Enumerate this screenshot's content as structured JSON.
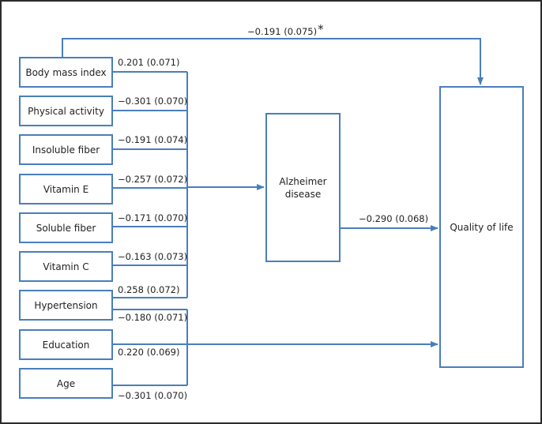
{
  "diagram": {
    "line_color": "#4a7ebb",
    "predictors": [
      {
        "label": "Body mass index"
      },
      {
        "label": "Physical activity"
      },
      {
        "label": "Insoluble fiber"
      },
      {
        "label": "Vitamin E"
      },
      {
        "label": "Soluble fiber"
      },
      {
        "label": "Vitamin C"
      },
      {
        "label": "Hypertension"
      },
      {
        "label": "Education"
      },
      {
        "label": "Age"
      }
    ],
    "mediator": {
      "label_line1": "Alzheimer",
      "label_line2": "disease"
    },
    "outcome": {
      "label": "Quality of life"
    },
    "paths_to_alzheimer": [
      {
        "from": "Body mass index",
        "coef": "0.201 (0.071)"
      },
      {
        "from": "Physical activity",
        "coef": "−0.301 (0.070)"
      },
      {
        "from": "Insoluble fiber",
        "coef": "−0.191 (0.074)"
      },
      {
        "from": "Vitamin E",
        "coef": "−0.257 (0.072)"
      },
      {
        "from": "Soluble fiber",
        "coef": "−0.171 (0.070)"
      },
      {
        "from": "Vitamin C",
        "coef": "−0.163 (0.073)"
      },
      {
        "from": "Hypertension",
        "coef": "0.258 (0.072)"
      }
    ],
    "paths_to_quality_of_life": [
      {
        "from": "Hypertension",
        "coef": "−0.180 (0.071)"
      },
      {
        "from": "Education",
        "coef": "0.220 (0.069)"
      },
      {
        "from": "Age",
        "coef": "−0.301 (0.070)"
      }
    ],
    "direct_path": {
      "from": "Body mass index",
      "to": "Quality of life",
      "coef": "−0.191 (0.075)",
      "marker": "*"
    },
    "mediator_path": {
      "from": "Alzheimer disease",
      "to": "Quality of life",
      "coef": "−0.290 (0.068)"
    }
  }
}
